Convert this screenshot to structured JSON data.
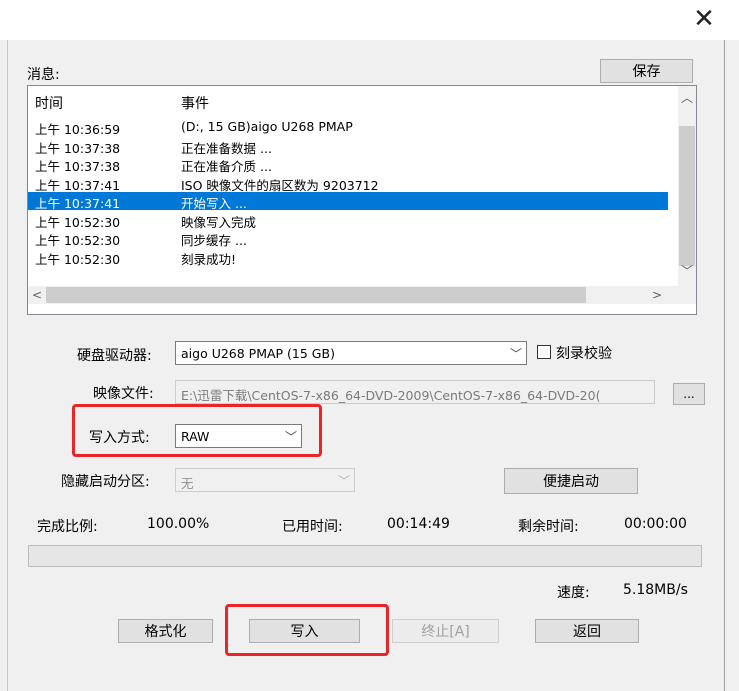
{
  "window": {
    "close_glyph": "✕"
  },
  "messages": {
    "label": "消息:",
    "save_button": "保存",
    "columns": {
      "time": "时间",
      "event": "事件"
    },
    "rows": [
      {
        "time": "上午 10:36:59",
        "event": "(D:, 15 GB)aigo    U268            PMAP",
        "selected": false
      },
      {
        "time": "上午 10:37:38",
        "event": "正在准备数据 ...",
        "selected": false
      },
      {
        "time": "上午 10:37:38",
        "event": "正在准备介质 ...",
        "selected": false
      },
      {
        "time": "上午 10:37:41",
        "event": "ISO 映像文件的扇区数为 9203712",
        "selected": false
      },
      {
        "time": "上午 10:37:41",
        "event": "开始写入 ...",
        "selected": true
      },
      {
        "time": "上午 10:52:30",
        "event": "映像写入完成",
        "selected": false
      },
      {
        "time": "上午 10:52:30",
        "event": "同步缓存 ...",
        "selected": false
      },
      {
        "time": "上午 10:52:30",
        "event": "刻录成功!",
        "selected": false
      }
    ]
  },
  "form": {
    "drive_label": "硬盘驱动器:",
    "drive_value": "aigo    U268            PMAP (15 GB)",
    "verify_label": "刻录校验",
    "verify_checked": false,
    "image_label": "映像文件:",
    "image_value": "E:\\迅雷下载\\CentOS-7-x86_64-DVD-2009\\CentOS-7-x86_64-DVD-20(",
    "browse_button": "...",
    "write_mode_label": "写入方式:",
    "write_mode_value": "RAW",
    "hidden_partition_label": "隐藏启动分区:",
    "hidden_partition_value": "无",
    "quick_boot_button": "便捷启动"
  },
  "status": {
    "complete_label": "完成比例:",
    "complete_value": "100.00%",
    "elapsed_label": "已用时间:",
    "elapsed_value": "00:14:49",
    "remaining_label": "剩余时间:",
    "remaining_value": "00:00:00",
    "progress_fraction": 0,
    "speed_label": "速度:",
    "speed_value": "5.18MB/s"
  },
  "actions": {
    "format": "格式化",
    "write": "写入",
    "stop": "终止[A]",
    "back": "返回"
  },
  "colors": {
    "selection": "#0078d7",
    "highlight": "#e8262a"
  }
}
